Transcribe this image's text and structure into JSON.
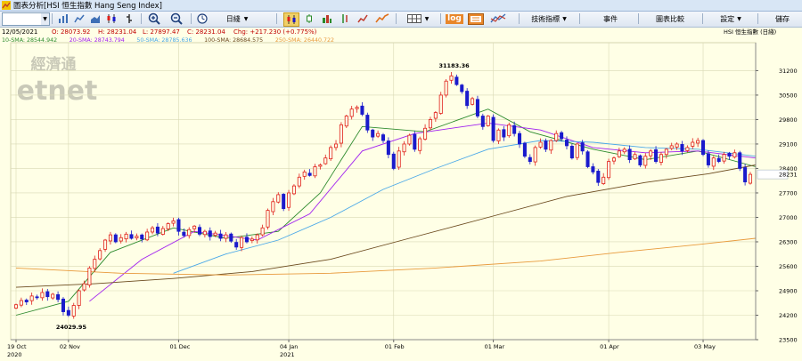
{
  "window": {
    "title": "圖表分析[HSI 恒生指數 Hang Seng Index]"
  },
  "toolbar": {
    "period_label": "日綫",
    "indicators_label": "技術指標",
    "events_label": "事件",
    "compare_label": "圖表比較",
    "settings_label": "設定",
    "save_label": "儲存",
    "log_label": "log"
  },
  "info": {
    "date": "12/05/2021",
    "open": "O: 28073.92",
    "high": "H: 28231.04",
    "low": "L: 27897.47",
    "close": "C: 28231.04",
    "change": "Chg: +217.230 (+0.775%)",
    "symbol_label": "HSI  恒生指數 (日綫)"
  },
  "ma_legend": [
    {
      "label": "10-SMA: 28544.942",
      "color": "#2e8b2e"
    },
    {
      "label": "20-SMA: 28743.794",
      "color": "#a020f0"
    },
    {
      "label": "50-SMA: 28785.636",
      "color": "#4aa8e8"
    },
    {
      "label": "100-SMA: 28684.575",
      "color": "#6b4a1e"
    },
    {
      "label": "250-SMA: 26440.722",
      "color": "#e89a3c"
    }
  ],
  "watermark": {
    "cn": "經濟通",
    "en": "etnet"
  },
  "colors": {
    "up": "#e0201a",
    "down": "#1a1acc",
    "bg": "#ffffe6"
  },
  "chart_data": {
    "type": "candlestick",
    "ylim": [
      23500,
      32000
    ],
    "yticks": [
      23500,
      24200,
      24900,
      25600,
      26300,
      27000,
      27700,
      28400,
      29100,
      29800,
      30500,
      31200
    ],
    "last_price_label": "28231",
    "x_labels": [
      {
        "label": "19 Oct",
        "index": 0,
        "year": "2020"
      },
      {
        "label": "02 Nov",
        "index": 10
      },
      {
        "label": "01 Dec",
        "index": 31
      },
      {
        "label": "04 Jan",
        "index": 52,
        "year": "2021"
      },
      {
        "label": "01 Feb",
        "index": 72
      },
      {
        "label": "01 Mar",
        "index": 91
      },
      {
        "label": "01 Apr",
        "index": 113
      },
      {
        "label": "03 May",
        "index": 131
      }
    ],
    "annotations": [
      {
        "label": "31183.36",
        "index": 83,
        "value": 31183.36,
        "pos": "above"
      },
      {
        "label": "24029.95",
        "index": 10,
        "value": 24029.95,
        "pos": "below"
      }
    ],
    "closes": [
      24500,
      24620,
      24580,
      24750,
      24700,
      24850,
      24730,
      24800,
      24650,
      24300,
      24200,
      24480,
      24900,
      25100,
      25550,
      25800,
      26050,
      26350,
      26500,
      26300,
      26420,
      26520,
      26400,
      26460,
      26380,
      26580,
      26700,
      26550,
      26680,
      26820,
      26900,
      26600,
      26480,
      26650,
      26750,
      26520,
      26600,
      26450,
      26550,
      26400,
      26500,
      26320,
      26150,
      26420,
      26300,
      26380,
      26500,
      26700,
      27200,
      27450,
      27650,
      27250,
      27700,
      27900,
      28150,
      28300,
      28200,
      28450,
      28500,
      28700,
      29000,
      29100,
      29650,
      29900,
      30100,
      30150,
      29950,
      29500,
      29300,
      29400,
      29200,
      28800,
      28400,
      28900,
      29100,
      29350,
      28950,
      29250,
      29550,
      29800,
      30000,
      30500,
      30900,
      31050,
      30800,
      30600,
      30200,
      30400,
      29900,
      29600,
      29900,
      29200,
      29500,
      29300,
      29650,
      29400,
      29100,
      28750,
      28600,
      29000,
      29150,
      28950,
      29200,
      29400,
      29250,
      29050,
      28700,
      29100,
      28900,
      28450,
      28300,
      28000,
      28150,
      28600,
      28700,
      28900,
      28950,
      28650,
      28800,
      28500,
      28750,
      28900,
      28600,
      28800,
      28950,
      29050,
      29100,
      28900,
      29000,
      29150,
      29200,
      28800,
      28500,
      28700,
      28600,
      28800,
      28750,
      28850,
      28400,
      28014,
      28231
    ],
    "ma": [
      {
        "name": "10-SMA",
        "color": "#2e8b2e",
        "points": [
          [
            0,
            24200
          ],
          [
            10,
            24600
          ],
          [
            18,
            26000
          ],
          [
            30,
            26700
          ],
          [
            40,
            26400
          ],
          [
            50,
            26600
          ],
          [
            58,
            27700
          ],
          [
            66,
            29600
          ],
          [
            78,
            29450
          ],
          [
            90,
            30100
          ],
          [
            98,
            29450
          ],
          [
            110,
            28950
          ],
          [
            120,
            28650
          ],
          [
            130,
            28900
          ],
          [
            141,
            28450
          ]
        ]
      },
      {
        "name": "20-SMA",
        "color": "#a020f0",
        "points": [
          [
            14,
            24600
          ],
          [
            24,
            25800
          ],
          [
            34,
            26600
          ],
          [
            46,
            26350
          ],
          [
            56,
            27100
          ],
          [
            66,
            28900
          ],
          [
            76,
            29400
          ],
          [
            90,
            29700
          ],
          [
            100,
            29500
          ],
          [
            110,
            29000
          ],
          [
            120,
            28850
          ],
          [
            130,
            28900
          ],
          [
            141,
            28700
          ]
        ]
      },
      {
        "name": "50-SMA",
        "color": "#4aa8e8",
        "points": [
          [
            30,
            25400
          ],
          [
            40,
            25950
          ],
          [
            50,
            26350
          ],
          [
            60,
            27000
          ],
          [
            70,
            27800
          ],
          [
            80,
            28400
          ],
          [
            90,
            28950
          ],
          [
            100,
            29200
          ],
          [
            110,
            29150
          ],
          [
            120,
            29000
          ],
          [
            130,
            28950
          ],
          [
            141,
            28750
          ]
        ]
      },
      {
        "name": "100-SMA",
        "color": "#6b4a1e",
        "points": [
          [
            0,
            25000
          ],
          [
            15,
            25100
          ],
          [
            30,
            25250
          ],
          [
            45,
            25450
          ],
          [
            60,
            25800
          ],
          [
            75,
            26400
          ],
          [
            90,
            27000
          ],
          [
            105,
            27600
          ],
          [
            120,
            28000
          ],
          [
            132,
            28250
          ],
          [
            141,
            28500
          ]
        ]
      },
      {
        "name": "250-SMA",
        "color": "#e89a3c",
        "points": [
          [
            0,
            25550
          ],
          [
            20,
            25400
          ],
          [
            40,
            25350
          ],
          [
            60,
            25400
          ],
          [
            80,
            25550
          ],
          [
            100,
            25750
          ],
          [
            115,
            26000
          ],
          [
            130,
            26220
          ],
          [
            141,
            26400
          ]
        ]
      }
    ]
  }
}
